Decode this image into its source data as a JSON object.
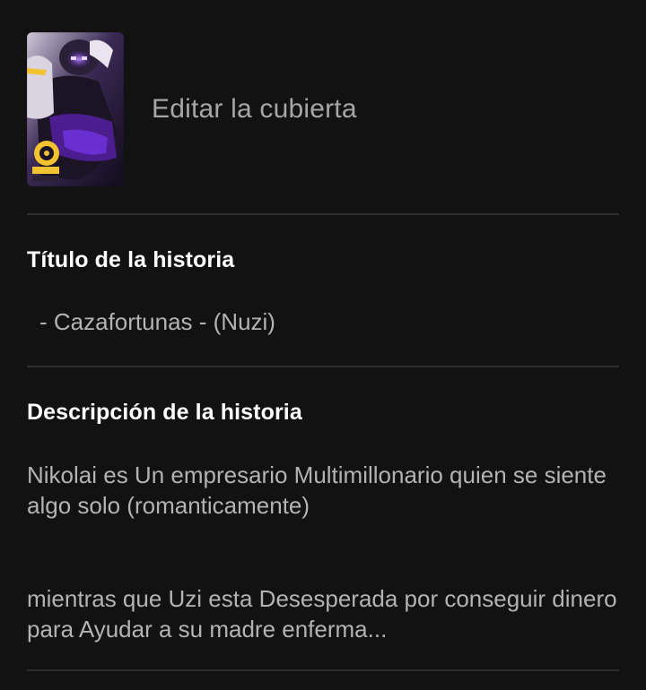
{
  "cover": {
    "image_icon": "cover-art-thumbnail",
    "edit_label": "Editar la cubierta"
  },
  "title_section": {
    "heading": "Título de la historia",
    "value": "- Cazafortunas - (Nuzi)"
  },
  "description_section": {
    "heading": "Descripción de la historia",
    "paragraph_1": "Nikolai es Un empresario Multimillonario quien se siente algo solo (romanticamente)",
    "paragraph_2": "mientras que Uzi esta Desesperada por conseguir dinero para Ayudar a su madre enferma..."
  },
  "colors": {
    "background": "#121212",
    "divider": "#2e2e2e",
    "heading_text": "#ffffff",
    "body_text": "#b3b3b3",
    "accent_purple": "#7a3cff",
    "accent_yellow": "#f2c230"
  }
}
